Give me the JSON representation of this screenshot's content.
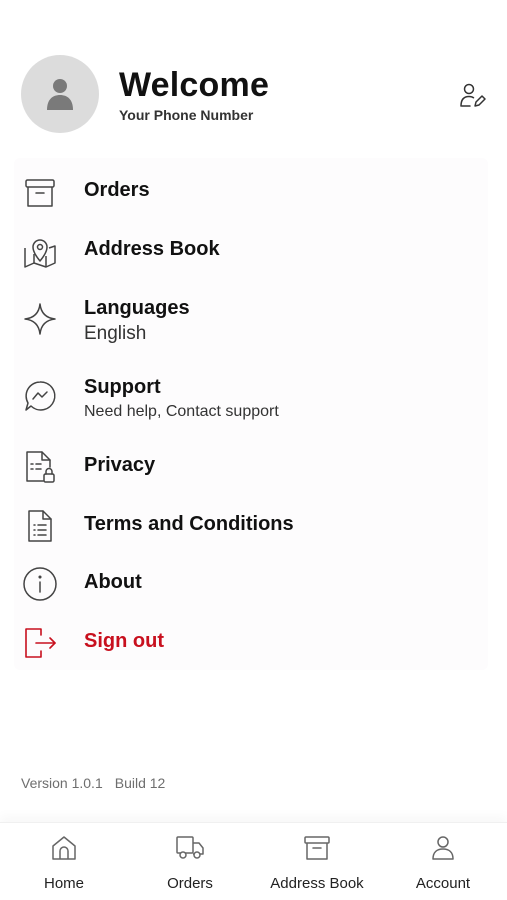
{
  "header": {
    "title": "Welcome",
    "subtitle": "Your Phone Number",
    "avatar_icon": "user-silhouette-icon",
    "edit_icon": "edit-profile-icon"
  },
  "menu": {
    "items": [
      {
        "label": "Orders",
        "icon": "archive-box-icon"
      },
      {
        "label": "Address Book",
        "icon": "map-pin-icon"
      },
      {
        "label": "Languages",
        "sub": "English",
        "icon": "sparkle-icon"
      },
      {
        "label": "Support",
        "sub": "Need help, Contact support",
        "icon": "chat-bubble-icon"
      },
      {
        "label": "Privacy",
        "icon": "document-lock-icon"
      },
      {
        "label": "Terms and Conditions",
        "icon": "document-list-icon"
      },
      {
        "label": "About",
        "icon": "info-circle-icon"
      },
      {
        "label": "Sign out",
        "icon": "sign-out-icon"
      }
    ]
  },
  "footer": {
    "version": "Version 1.0.1",
    "build": "Build 12"
  },
  "bottom_nav": {
    "tabs": [
      {
        "label": "Home",
        "icon": "home-icon"
      },
      {
        "label": "Orders",
        "icon": "truck-icon"
      },
      {
        "label": "Address Book",
        "icon": "archive-box-icon"
      },
      {
        "label": "Account",
        "icon": "user-icon"
      }
    ]
  },
  "colors": {
    "accent_danger": "#c8101e",
    "text_primary": "#111111",
    "text_secondary": "#333333",
    "muted": "#6e6e6e",
    "avatar_bg": "#dcdcdc"
  }
}
